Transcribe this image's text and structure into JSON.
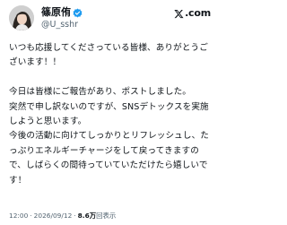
{
  "header": {
    "display_name": "篠原侑",
    "handle": "@U_sshr",
    "logo_text": ".com",
    "icons": {
      "avatar": "profile-photo",
      "verified": "verified-badge-icon",
      "logo": "x-logo-icon"
    }
  },
  "post": {
    "text": "いつも応援してくださっている皆様、ありがとうございます！！\n\n今日は皆様にご報告があり、ポストしました。\n突然で申し訳ないのですが、SNSデトックスを実施しようと思います。\n今後の活動に向けてしっかりとリフレッシュし、たっぷりエネルギーチャージをして戻ってきますので、しばらくの間待っていていただけたら嬉しいです！"
  },
  "meta": {
    "time": "12:00",
    "separator": "·",
    "date": "2026/09/12",
    "views_count": "8.6万",
    "views_label": "回表示"
  },
  "colors": {
    "text": "#0f1419",
    "secondary": "#536471",
    "verified": "#1d9bf0",
    "background": "#ffffff"
  }
}
